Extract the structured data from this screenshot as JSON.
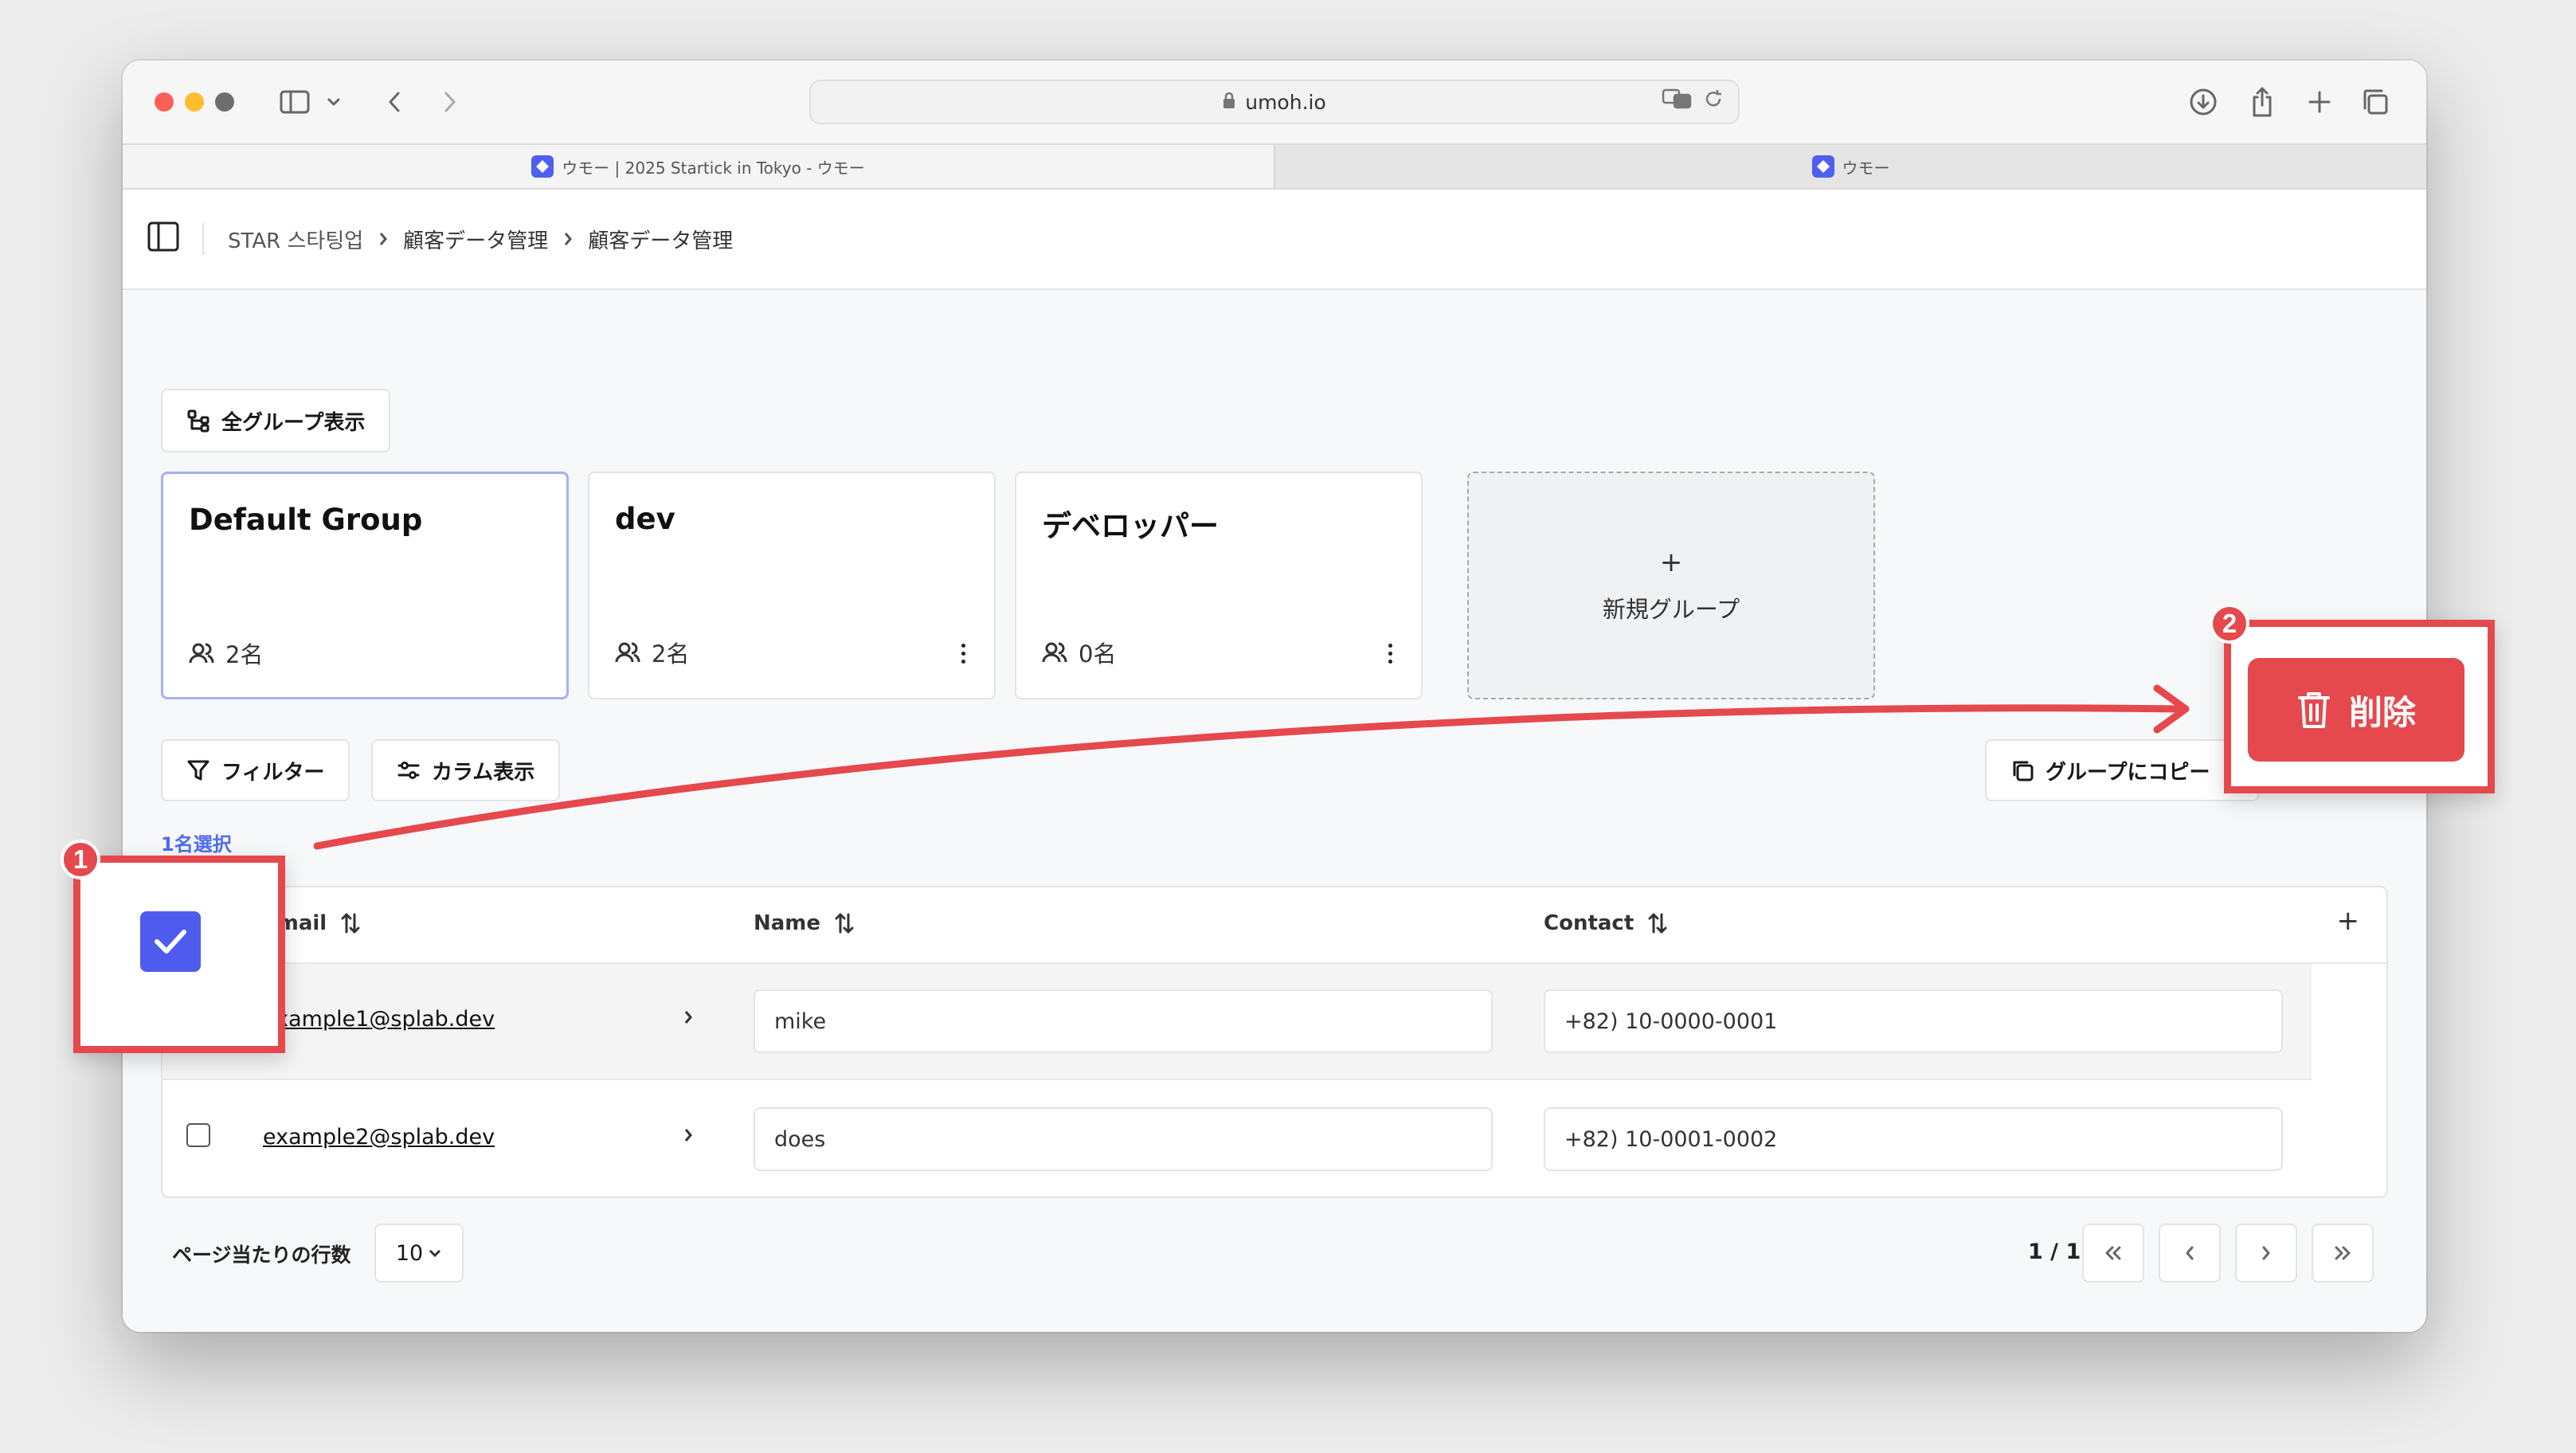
{
  "browser": {
    "url": "umoh.io",
    "tabs": [
      {
        "title": "ウモー | 2025 Startick in Tokyo - ウモー",
        "active": true
      },
      {
        "title": "ウモー",
        "active": false
      }
    ]
  },
  "breadcrumb": [
    "STAR 스타팅업",
    "顧客データ管理",
    "顧客データ管理"
  ],
  "toolbar": {
    "all_groups_label": "全グループ表示"
  },
  "groups": [
    {
      "name": "Default Group",
      "count": "2名",
      "selected": true
    },
    {
      "name": "dev",
      "count": "2名",
      "selected": false
    },
    {
      "name": "デベロッパー",
      "count": "0名",
      "selected": false
    }
  ],
  "new_group": {
    "plus": "+",
    "label": "新規グループ"
  },
  "filters": {
    "filter_label": "フィルター",
    "columns_label": "カラム表示",
    "copy_label": "グループにコピー"
  },
  "selection": {
    "count_text": "1名選択"
  },
  "table": {
    "headers": {
      "email": "Email",
      "name": "Name",
      "contact": "Contact",
      "add": "+"
    },
    "rows": [
      {
        "email": "example1@splab.dev",
        "name": "mike",
        "contact": "+82) 10-0000-0001",
        "checked": true
      },
      {
        "email": "example2@splab.dev",
        "name": "does",
        "contact": "+82) 10-0001-0002",
        "checked": false
      }
    ]
  },
  "pagination": {
    "rows_label": "ページ当たりの行数",
    "rows_value": "10",
    "page_info": "1 / 1"
  },
  "annotations": {
    "step1": "1",
    "step2": "2",
    "delete_label": "削除",
    "accent_color": "#e5484d",
    "check_color": "#4f5bed"
  }
}
